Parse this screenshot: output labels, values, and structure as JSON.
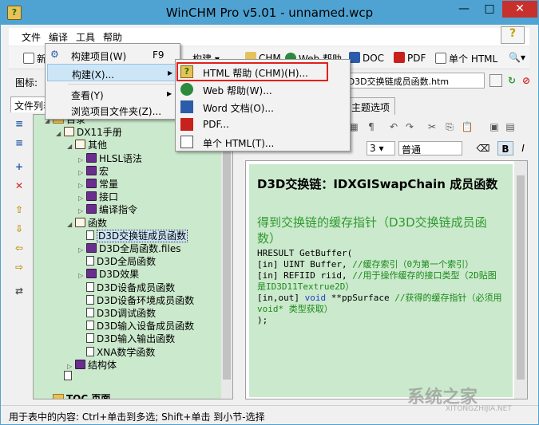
{
  "window": {
    "title": "WinCHM Pro v5.01 - unnamed.wcp",
    "minimize": "—",
    "maximize": "□",
    "close": "✕"
  },
  "menubar": {
    "items": [
      "文件",
      "编译",
      "工具",
      "帮助"
    ]
  },
  "toolbar": {
    "new": "新",
    "build": "构建",
    "chm": "CHM",
    "web": "Web 帮助",
    "doc": "DOC",
    "pdf": "PDF",
    "single_html": "单个 HTML"
  },
  "iconbar": {
    "label": "图标:",
    "path": "函数\\D3D交换链成员函数.htm"
  },
  "left_panel": {
    "tab": "文件列表",
    "tree": [
      {
        "label": "目录",
        "indent": 0,
        "kind": "folder",
        "arrow": "◢"
      },
      {
        "label": "DX11手册",
        "indent": 1,
        "kind": "obook",
        "arrow": "◢"
      },
      {
        "label": "其他",
        "indent": 2,
        "kind": "obook",
        "arrow": "◢"
      },
      {
        "label": "HLSL语法",
        "indent": 3,
        "kind": "book",
        "arrow": "▷"
      },
      {
        "label": "宏",
        "indent": 3,
        "kind": "book",
        "arrow": "▷"
      },
      {
        "label": "常量",
        "indent": 3,
        "kind": "book",
        "arrow": "▷"
      },
      {
        "label": "接口",
        "indent": 3,
        "kind": "book",
        "arrow": "▷"
      },
      {
        "label": "编译指令",
        "indent": 3,
        "kind": "book",
        "arrow": "▷"
      },
      {
        "label": "函数",
        "indent": 2,
        "kind": "obook",
        "arrow": "◢"
      },
      {
        "label": "D3D交换链成员函数",
        "indent": 3,
        "kind": "page",
        "arrow": "",
        "selected": true
      },
      {
        "label": "D3D全局函数.files",
        "indent": 3,
        "kind": "book",
        "arrow": "▷"
      },
      {
        "label": "D3D全局函数",
        "indent": 3,
        "kind": "page",
        "arrow": ""
      },
      {
        "label": "D3D效果",
        "indent": 3,
        "kind": "book",
        "arrow": "▷"
      },
      {
        "label": "D3D设备成员函数",
        "indent": 3,
        "kind": "page",
        "arrow": ""
      },
      {
        "label": "D3D设备环境成员函数",
        "indent": 3,
        "kind": "page",
        "arrow": ""
      },
      {
        "label": "D3D调试函数",
        "indent": 3,
        "kind": "page",
        "arrow": ""
      },
      {
        "label": "D3D输入设备成员函数",
        "indent": 3,
        "kind": "page",
        "arrow": ""
      },
      {
        "label": "D3D输入输出函数",
        "indent": 3,
        "kind": "page",
        "arrow": ""
      },
      {
        "label": "XNA数学函数",
        "indent": 3,
        "kind": "page",
        "arrow": ""
      },
      {
        "label": "结构体",
        "indent": 2,
        "kind": "book",
        "arrow": "▷"
      },
      {
        "label": "",
        "indent": 1,
        "kind": "page",
        "arrow": ""
      },
      {
        "label": "TOC 页面",
        "indent": 0,
        "kind": "folder",
        "arrow": "",
        "bold": true
      }
    ]
  },
  "right_panel": {
    "tab_fragment": "页",
    "tab_topic_options": "主题选项",
    "font_size": "3",
    "style": "普通",
    "bold": "B",
    "italic": "I",
    "heading1": "D3D交换链：IDXGISwapChain 成员函数",
    "heading2": "得到交换链的缓存指针（D3D交换链成员函数）",
    "code": {
      "l1": "HRESULT GetBuffer(",
      "l2a": "    [in] UINT Buffer, ",
      "l2b": "//缓存索引（0为第一个索引）",
      "l3a": "    [in] REFIID riid, ",
      "l3b": "//用于操作缓存的接口类型（2D贴图是ID3D11Textrue2D）",
      "l4a": "    [in,out] ",
      "l4kw": "void",
      "l4b": " **ppSurface ",
      "l4c": "//获得的缓存指针（必须用 void* 类型获取）",
      "l5": ");"
    }
  },
  "statusbar": {
    "text": "用于表中的内容: Ctrl+单击到多选; Shift+单击 到小节-选择"
  },
  "build_menu": {
    "items": [
      {
        "label": "构建项目(W)",
        "shortcut": "F9"
      },
      {
        "label": "构建(X)...",
        "arrow": "▶"
      },
      {
        "label": "查看(Y)",
        "arrow": "▶"
      },
      {
        "label": "浏览项目文件夹(Z)..."
      }
    ]
  },
  "build_submenu": {
    "items": [
      {
        "label": "HTML 帮助 (CHM)(H)..."
      },
      {
        "label": "Web 帮助(W)..."
      },
      {
        "label": "Word 文档(O)..."
      },
      {
        "label": "PDF..."
      },
      {
        "label": "单个 HTML(T)..."
      }
    ]
  },
  "watermark": {
    "text": "系统之家",
    "sub": "XITONGZHIJIA.NET"
  },
  "colors": {
    "titlebar": "#4fa3d3",
    "tree_bg": "#cbe9cc",
    "highlight_box": "#e2201b",
    "heading_green": "#2f9a2f"
  }
}
